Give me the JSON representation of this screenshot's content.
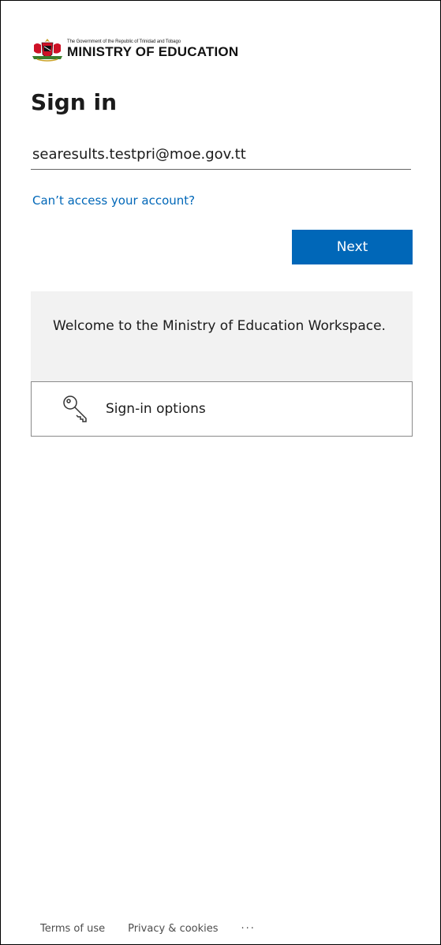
{
  "logo": {
    "small_text": "The Government of the Republic of Trinidad and Tobago",
    "big_text": "MINISTRY OF EDUCATION"
  },
  "title": "Sign in",
  "email": {
    "value": "searesults.testpri@moe.gov.tt"
  },
  "cant_access_link": "Can’t access your account?",
  "next_button": "Next",
  "welcome_text": "Welcome to the Ministry of Education Workspace.",
  "signin_options": {
    "label": "Sign-in options",
    "icon": "key-icon"
  },
  "footer": {
    "terms": "Terms of use",
    "privacy": "Privacy & cookies",
    "more": "···"
  },
  "colors": {
    "accent": "#0067b8",
    "panel_bg": "#f2f2f2"
  }
}
